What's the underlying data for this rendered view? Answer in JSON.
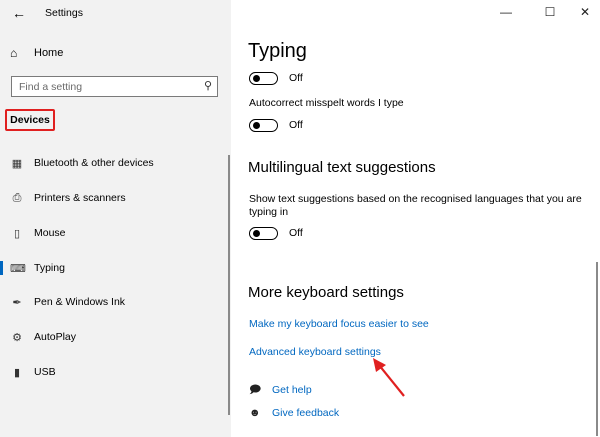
{
  "window": {
    "title": "Settings",
    "back_icon": "back-arrow-icon",
    "minimize": "—",
    "maximize": "☐",
    "close": "✕"
  },
  "sidebar": {
    "home_label": "Home",
    "search_placeholder": "Find a setting",
    "section": "Devices",
    "items": [
      {
        "label": "Bluetooth & other devices",
        "icon": "bluetooth-icon"
      },
      {
        "label": "Printers & scanners",
        "icon": "printer-icon"
      },
      {
        "label": "Mouse",
        "icon": "mouse-icon"
      },
      {
        "label": "Typing",
        "icon": "keyboard-icon",
        "selected": true
      },
      {
        "label": "Pen & Windows Ink",
        "icon": "pen-icon"
      },
      {
        "label": "AutoPlay",
        "icon": "autoplay-icon"
      },
      {
        "label": "USB",
        "icon": "usb-icon"
      }
    ]
  },
  "main": {
    "typing_heading": "Typing",
    "toggle1_state": "Off",
    "autocorrect_label": "Autocorrect misspelt words I type",
    "toggle2_state": "Off",
    "multilingual_heading": "Multilingual text suggestions",
    "multilingual_desc_line1": "Show text suggestions based on the recognised languages that you are",
    "multilingual_desc_line2": "typing in",
    "toggle3_state": "Off",
    "more_heading": "More keyboard settings",
    "link_focus": "Make my keyboard focus easier to see",
    "link_advanced": "Advanced keyboard settings",
    "get_help": "Get help",
    "give_feedback": "Give feedback"
  },
  "colors": {
    "accent": "#0067c0",
    "highlight": "#e02020",
    "sidebar_bg": "#f2f2f2"
  }
}
